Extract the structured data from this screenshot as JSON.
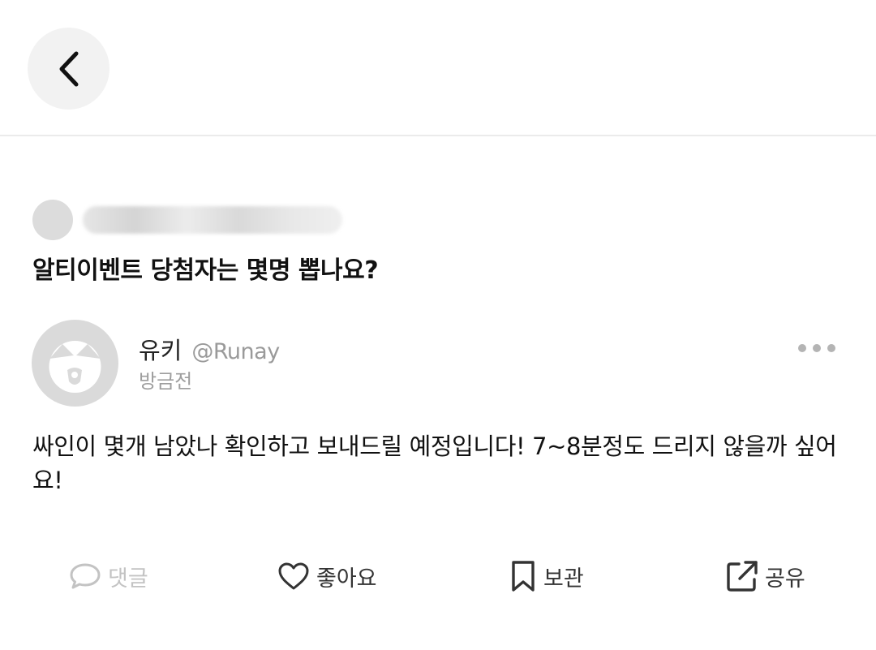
{
  "header": {
    "back_icon": "chevron-left-icon"
  },
  "question": {
    "text": "알티이벤트 당첨자는 몇명 뽑나요?"
  },
  "answer": {
    "name": "유키",
    "handle": "@Runay",
    "time": "방금전",
    "body": "싸인이 몇개 남았나 확인하고 보내드릴 예정입니다! 7~8분정도 드리지 않을까 싶어요!"
  },
  "actions": {
    "comment_label": "댓글",
    "like_label": "좋아요",
    "save_label": "보관",
    "share_label": "공유"
  },
  "colors": {
    "disabled": "#c3c3c3",
    "icon": "#333333",
    "muted": "#9a9a9a"
  }
}
